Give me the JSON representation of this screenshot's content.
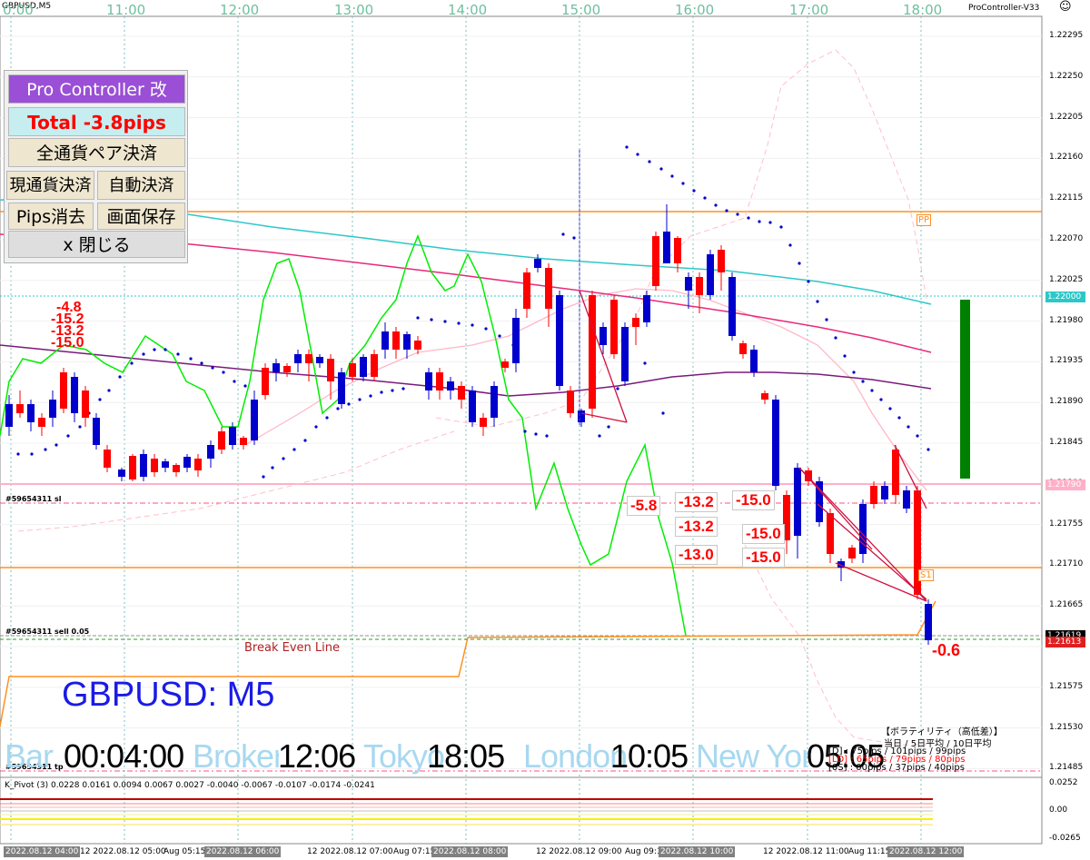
{
  "window": {
    "symbol_title": "GBPUSD,M5",
    "indicator_name": "ProController-V33",
    "smiley": "☺"
  },
  "time_axis": {
    "top_labels": [
      "0:00",
      "11:00",
      "12:00",
      "13:00",
      "14:00",
      "15:00",
      "16:00",
      "17:00",
      "18:00"
    ],
    "bottom_labels": [
      "2022.08.12 04:00",
      "12 2022.08.12 05:00",
      "Aug 05:15",
      "2022.08.12 06:00",
      "12 2022.08.12 07:00",
      "Aug 07:15",
      "2022.08.12 08:00",
      "12 2022.08.12 09:00",
      "Aug 09:15",
      "2022.08.12 10:00",
      "12 2022.08.12 11:00",
      "Aug 11:15",
      "2022.08.12 12:00"
    ]
  },
  "price_axis": {
    "labels": [
      "1.22295",
      "1.22250",
      "1.22205",
      "1.22160",
      "1.22115",
      "1.22070",
      "1.22025",
      "1.21980",
      "1.21935",
      "1.21890",
      "1.21845",
      "1.21800",
      "1.21755",
      "1.21710",
      "1.21665",
      "1.21620",
      "1.21575",
      "1.21530",
      "1.21485"
    ],
    "boxes": {
      "level_blue": "1.22000",
      "level_pink": "1.21790",
      "bid": "1.21619",
      "ask": "1.21613"
    }
  },
  "control_panel": {
    "title": "Pro Controller 改",
    "total": "Total   -3.8pips",
    "close_all_pairs": "全通貨ペア決済",
    "close_current": "現通貨決済",
    "auto_close": "自動決済",
    "erase_pips": "Pips消去",
    "save_screen": "画面保存",
    "close": "x 閉じる"
  },
  "chart_labels": {
    "pp": "PP",
    "s1": "S1",
    "break_even": "Break Even Line",
    "order_sl": "#59654311 sl",
    "order_sell": "#59654311 sell 0.05",
    "order_tp": "#59654311 tp"
  },
  "pips_labels": {
    "left_stack": [
      "-4.8",
      "-15.2",
      "-13.2",
      "-15.0"
    ],
    "boxes": [
      "-5.8",
      "-13.2",
      "-15.0",
      "-13.2",
      "-15.0",
      "-13.0",
      "-15.0"
    ],
    "current": "-0.6"
  },
  "overlay": {
    "pair": "GBPUSD: M5",
    "row_labels": [
      "Bar",
      "Broker",
      "Tokyo",
      "London",
      "New York"
    ],
    "row_times": [
      "00:04:00",
      "12:06",
      "18:05",
      "10:05",
      "05:05"
    ]
  },
  "volatility": {
    "title": "【ボラティリティ（高低差）】",
    "header": "当日 / 5日平均 / 10日平均",
    "rows": [
      "[D] : 75pips / 101pips /  99pips",
      "[LD] : 65pips /  79pips /  80pips",
      "[0S] :  00pips /  37pips /  40pips"
    ]
  },
  "subwindow": {
    "title": "K_Pivot (3) 0.0228 0.0161 0.0094 0.0067 0.0027 -0.0040 -0.0067 -0.0107 -0.0174 -0.0241",
    "scale": [
      "0.0252",
      "0.00",
      "-0.0265"
    ]
  },
  "colors": {
    "bull_candle": "#ff0000",
    "bear_candle": "#0000cc",
    "green_line": "#00ee00",
    "cyan_ma": "#2cc8c8",
    "magenta_ma": "#e8287a",
    "purple_ma": "#7a1a7a",
    "pink_band": "#ffb0c0",
    "pivot_line": "#ff9020",
    "overlay_blue": "#1a1ae6",
    "overlay_cyan": "#a8d8f0",
    "total_red": "#ff0000"
  }
}
